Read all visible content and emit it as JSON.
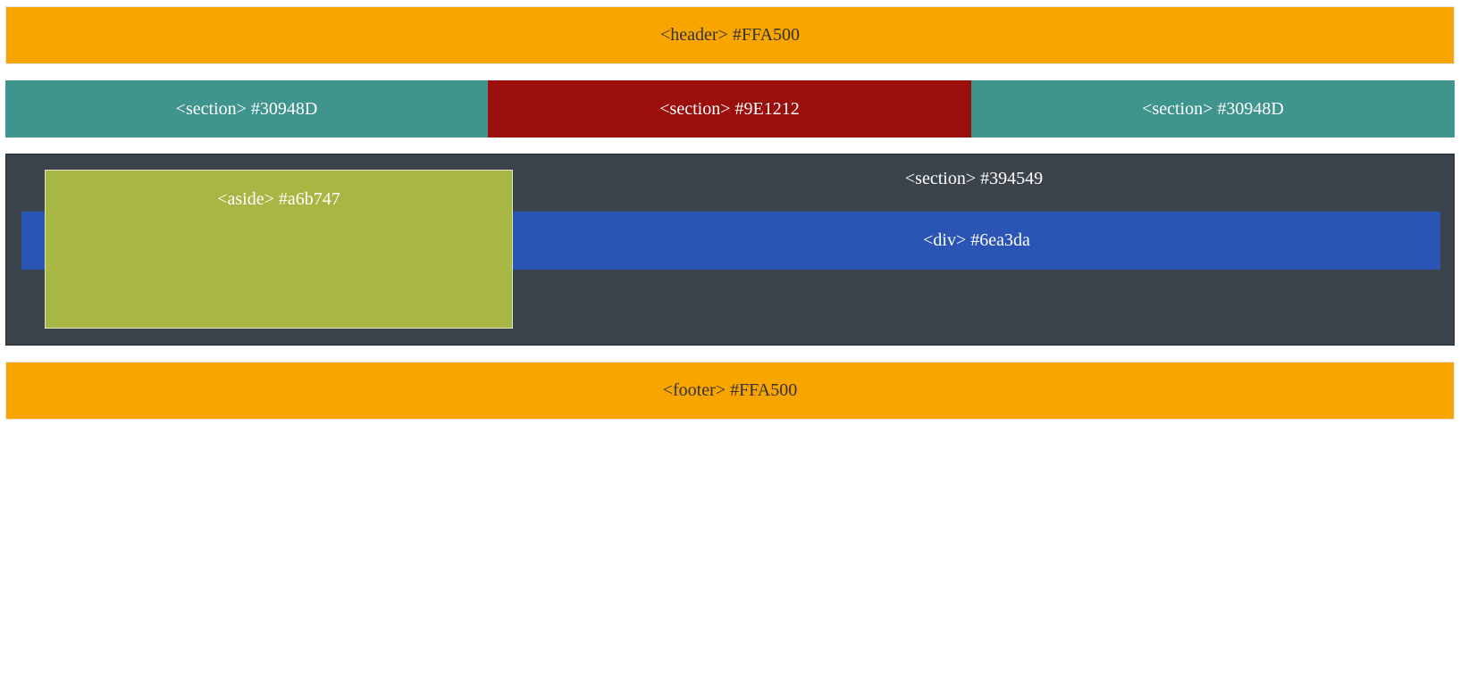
{
  "header": {
    "label": "<header> #FFA500",
    "color": "#F9A500"
  },
  "sections": [
    {
      "label": "<section> #30948D",
      "color": "#3F948D"
    },
    {
      "label": "<section> #9E1212",
      "color": "#9A0E0C"
    },
    {
      "label": "<section> #30948D",
      "color": "#3F948D"
    }
  ],
  "main_section": {
    "label": "<section> #394549",
    "color": "#3C444B",
    "div": {
      "label": "<div> #6ea3da",
      "color": "#2A55B5"
    },
    "aside": {
      "label": "<aside> #a6b747",
      "color": "#A8B644"
    }
  },
  "footer": {
    "label": "<footer> #FFA500",
    "color": "#F9A500"
  }
}
